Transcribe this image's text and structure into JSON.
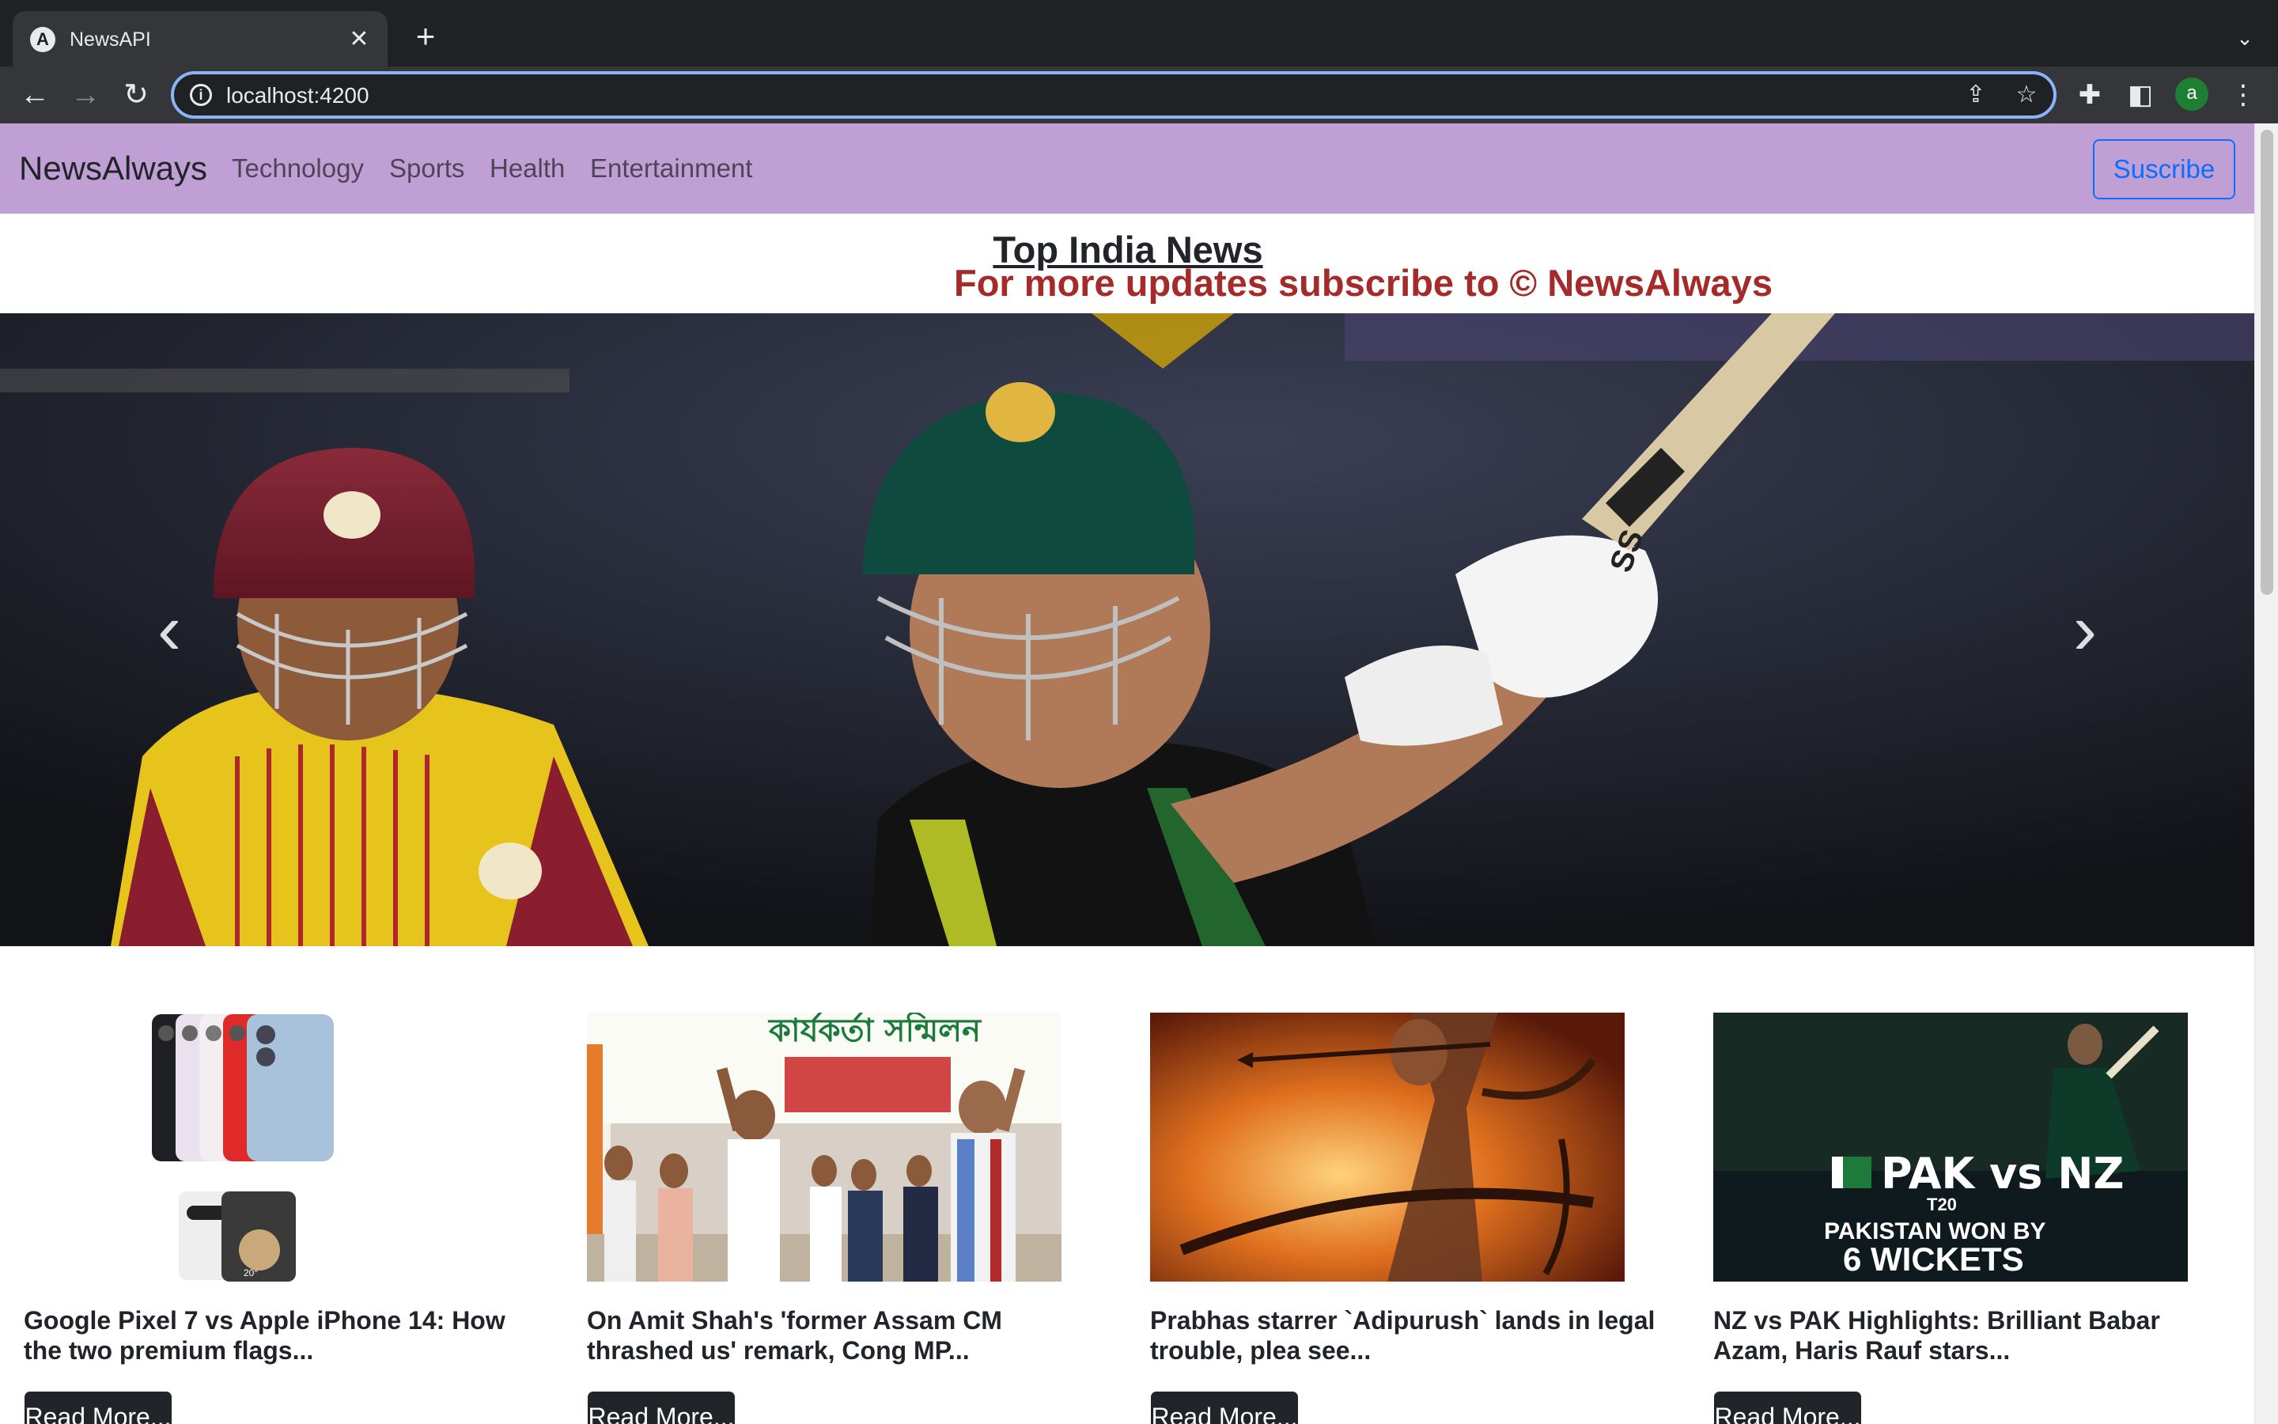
{
  "browser": {
    "tab_title": "NewsAPI",
    "tab_favicon": "A",
    "url": "localhost:4200",
    "avatar_letter": "a"
  },
  "navbar": {
    "brand": "NewsAlways",
    "links": [
      "Technology",
      "Sports",
      "Health",
      "Entertainment"
    ],
    "subscribe_label": "Suscribe"
  },
  "hero": {
    "heading": "Top India News",
    "subheading": "For more updates subscribe to © NewsAlways"
  },
  "cards": [
    {
      "title": "Google Pixel 7 vs Apple iPhone 14: How the two premium flags...",
      "button": "Read More..."
    },
    {
      "title": "On Amit Shah's 'former Assam CM thrashed us' remark, Cong MP...",
      "button": "Read More..."
    },
    {
      "title": "Prabhas starrer `Adipurush` lands in legal trouble, plea see...",
      "button": "Read More..."
    },
    {
      "title": "NZ vs PAK Highlights: Brilliant Babar Azam, Haris Rauf stars...",
      "button": "Read More..."
    }
  ],
  "card_image_text": {
    "assam_banner": "কাৰ্যকৰ্তা সন্মিলন",
    "pak_nz_line1": "PAK vs NZ",
    "pak_nz_line2": "T20",
    "pak_nz_line3": "PAKISTAN WON BY",
    "pak_nz_line4": "6 WICKETS"
  },
  "colors": {
    "navbar_bg": "#bf9fd4",
    "accent_red": "#a52a2a",
    "subscribe_blue": "#0d6efd",
    "button_dark": "#212529"
  }
}
